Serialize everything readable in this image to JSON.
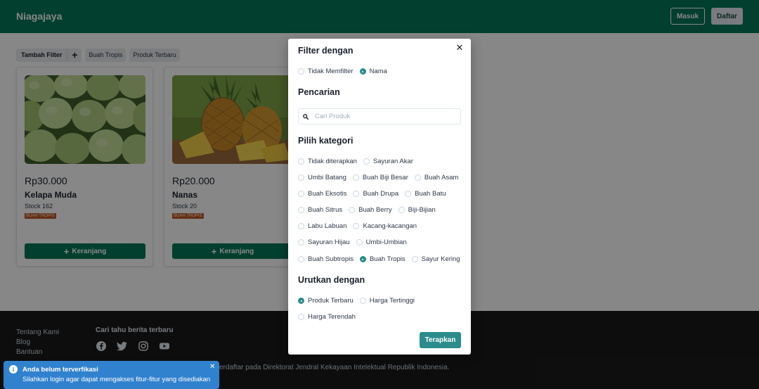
{
  "header": {
    "brand": "Niagajaya",
    "login_label": "Masuk",
    "register_label": "Daftar",
    "color": "#047857"
  },
  "filterbar": {
    "add_filter_label": "Tambah Filter",
    "plus_label": "+",
    "chips": [
      "Buah Tropis",
      "Produk Terbaru"
    ]
  },
  "products": [
    {
      "price": "Rp30.000",
      "name": "Kelapa Muda",
      "stock": "Stock 162",
      "badge": "BUAH TROPIS",
      "cart_label": "Keranjang",
      "image": "green-coconuts"
    },
    {
      "price": "Rp20.000",
      "name": "Nanas",
      "stock": "Stock 20",
      "badge": "BUAH TROPIS",
      "cart_label": "Keranjang",
      "image": "pineapples"
    }
  ],
  "footer": {
    "links": [
      "Tentang Kami",
      "Blog",
      "Bantuan"
    ],
    "news_title": "Cari tahu berita terbaru",
    "social_icons": [
      "facebook-icon",
      "twitter-icon",
      "instagram-icon",
      "youtube-icon"
    ],
    "copyright_fragment": "erdaftar pada Direktorat Jendral Kekayaan Intelektual Republik Indonesia."
  },
  "modal": {
    "title": "Filter dengan",
    "close_label": "✕",
    "filter_options": [
      {
        "label": "Tidak Memfilter",
        "checked": false
      },
      {
        "label": "Nama",
        "checked": true
      }
    ],
    "search_title": "Pencarian",
    "search_placeholder": "Cari Produk",
    "search_value": "",
    "category_title": "Pilih kategori",
    "category_rows": [
      [
        {
          "label": "Tidak diterapkan",
          "checked": false
        },
        {
          "label": "Sayuran Akar",
          "checked": false
        }
      ],
      [
        {
          "label": "Umbi Batang",
          "checked": false
        },
        {
          "label": "Buah Biji Besar",
          "checked": false
        },
        {
          "label": "Buah Asam",
          "checked": false
        }
      ],
      [
        {
          "label": "Buah Eksotis",
          "checked": false
        },
        {
          "label": "Buah Drupa",
          "checked": false
        },
        {
          "label": "Buah Batu",
          "checked": false
        }
      ],
      [
        {
          "label": "Buah Sitrus",
          "checked": false
        },
        {
          "label": "Buah Berry",
          "checked": false
        },
        {
          "label": "Biji-Bijian",
          "checked": false
        }
      ],
      [
        {
          "label": "Labu Labuan",
          "checked": false
        },
        {
          "label": "Kacang-kacangan",
          "checked": false
        }
      ],
      [
        {
          "label": "Sayuran Hijau",
          "checked": false
        },
        {
          "label": "Umbi-Umbian",
          "checked": false
        }
      ],
      [
        {
          "label": "Buah Subtropis",
          "checked": false
        },
        {
          "label": "Buah Tropis",
          "checked": true
        },
        {
          "label": "Sayur Kering",
          "checked": false
        }
      ]
    ],
    "sort_title": "Urutkan dengan",
    "sort_rows": [
      [
        {
          "label": "Produk Terbaru",
          "checked": true
        },
        {
          "label": "Harga Tertinggi",
          "checked": false
        }
      ],
      [
        {
          "label": "Harga Terendah",
          "checked": false
        }
      ]
    ],
    "apply_label": "Terapkan",
    "accent_color": "#2c8c8c"
  },
  "toast": {
    "title": "Anda belum terverfikasi",
    "message": "Silahkan login agar dapat mengakses fitur-fitur yang disediakan",
    "close_label": "✕",
    "color": "#3182ce"
  }
}
